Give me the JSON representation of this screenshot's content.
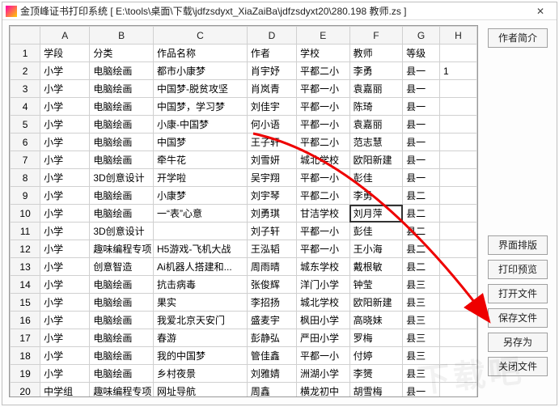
{
  "window": {
    "title": "金顶峰证书打印系统 [ E:\\tools\\桌面\\下载\\jdfzsdyxt_XiaZaiBa\\jdfzsdyxt20\\280.198 教师.zs ]",
    "close": "✕"
  },
  "columns": [
    "A",
    "B",
    "C",
    "D",
    "E",
    "F",
    "G",
    "H"
  ],
  "headers": {
    "A": "学段",
    "B": "分类",
    "C": "作品名称",
    "D": "作者",
    "E": "学校",
    "F": "教师",
    "G": "等级",
    "H": ""
  },
  "rows": [
    {
      "n": 1,
      "A": "学段",
      "B": "分类",
      "C": "作品名称",
      "D": "作者",
      "E": "学校",
      "F": "教师",
      "G": "等级",
      "H": ""
    },
    {
      "n": 2,
      "A": "小学",
      "B": "电脑绘画",
      "C": "都市小康梦",
      "D": "肖宇妤",
      "E": "平都二小",
      "F": "李勇",
      "G": "县一",
      "H": "1"
    },
    {
      "n": 3,
      "A": "小学",
      "B": "电脑绘画",
      "C": "中国梦-脱贫攻坚",
      "D": "肖岚青",
      "E": "平都一小",
      "F": "袁嘉丽",
      "G": "县一",
      "H": ""
    },
    {
      "n": 4,
      "A": "小学",
      "B": "电脑绘画",
      "C": "中国梦，学习梦",
      "D": "刘佳宇",
      "E": "平都一小",
      "F": "陈琦",
      "G": "县一",
      "H": ""
    },
    {
      "n": 5,
      "A": "小学",
      "B": "电脑绘画",
      "C": "小康-中国梦",
      "D": "何小语",
      "E": "平都一小",
      "F": "袁嘉丽",
      "G": "县一",
      "H": ""
    },
    {
      "n": 6,
      "A": "小学",
      "B": "电脑绘画",
      "C": "中国梦",
      "D": "王子轩",
      "E": "平都二小",
      "F": "范志慧",
      "G": "县一",
      "H": ""
    },
    {
      "n": 7,
      "A": "小学",
      "B": "电脑绘画",
      "C": "牵牛花",
      "D": "刘雪妍",
      "E": "城北学校",
      "F": "欧阳新建",
      "G": "县一",
      "H": ""
    },
    {
      "n": 8,
      "A": "小学",
      "B": "3D创意设计",
      "C": "开学啦",
      "D": "吴宇翔",
      "E": "平都一小",
      "F": "彭佳",
      "G": "县一",
      "H": ""
    },
    {
      "n": 9,
      "A": "小学",
      "B": "电脑绘画",
      "C": "小康梦",
      "D": "刘宇琴",
      "E": "平都二小",
      "F": "李勇",
      "G": "县二",
      "H": ""
    },
    {
      "n": 10,
      "A": "小学",
      "B": "电脑绘画",
      "C": "一“表”心意",
      "D": "刘勇琪",
      "E": "甘洁学校",
      "F": "刘月萍",
      "G": "县二",
      "H": ""
    },
    {
      "n": 11,
      "A": "小学",
      "B": "3D创意设计",
      "C": "",
      "D": "刘子轩",
      "E": "平都一小",
      "F": "彭佳",
      "G": "县二",
      "H": ""
    },
    {
      "n": 12,
      "A": "小学",
      "B": "趣味编程专项",
      "C": "H5游戏-飞机大战",
      "D": "王泓韬",
      "E": "平都一小",
      "F": "王小海",
      "G": "县二",
      "H": ""
    },
    {
      "n": 13,
      "A": "小学",
      "B": "创意智造",
      "C": "Ai机器人搭建和...",
      "D": "周雨晴",
      "E": "城东学校",
      "F": "戴根敏",
      "G": "县二",
      "H": ""
    },
    {
      "n": 14,
      "A": "小学",
      "B": "电脑绘画",
      "C": "抗击病毒",
      "D": "张俊辉",
      "E": "洋门小学",
      "F": "钟莹",
      "G": "县三",
      "H": ""
    },
    {
      "n": 15,
      "A": "小学",
      "B": "电脑绘画",
      "C": "果实",
      "D": "李招扬",
      "E": "城北学校",
      "F": "欧阳新建",
      "G": "县三",
      "H": ""
    },
    {
      "n": 16,
      "A": "小学",
      "B": "电脑绘画",
      "C": "我爱北京天安门",
      "D": "盛麦宇",
      "E": "枫田小学",
      "F": "高晓妹",
      "G": "县三",
      "H": ""
    },
    {
      "n": 17,
      "A": "小学",
      "B": "电脑绘画",
      "C": "春游",
      "D": "彭静弘",
      "E": "严田小学",
      "F": "罗梅",
      "G": "县三",
      "H": ""
    },
    {
      "n": 18,
      "A": "小学",
      "B": "电脑绘画",
      "C": "我的中国梦",
      "D": "管佳鑫",
      "E": "平都一小",
      "F": "付婷",
      "G": "县三",
      "H": ""
    },
    {
      "n": 19,
      "A": "小学",
      "B": "电脑绘画",
      "C": "乡村夜景",
      "D": "刘雅婧",
      "E": "洲湖小学",
      "F": "李赟",
      "G": "县三",
      "H": ""
    },
    {
      "n": 20,
      "A": "中学组",
      "B": "趣味编程专项",
      "C": "网址导航",
      "D": "周鑫",
      "E": "横龙初中",
      "F": "胡雪梅",
      "G": "县一",
      "H": ""
    }
  ],
  "highlight": {
    "row": 10,
    "col": "F"
  },
  "buttons": {
    "author": "作者简介",
    "layout": "界面排版",
    "preview": "打印预览",
    "open": "打开文件",
    "save": "保存文件",
    "saveas": "另存为",
    "close": "关闭文件"
  },
  "watermark": "下载吧"
}
